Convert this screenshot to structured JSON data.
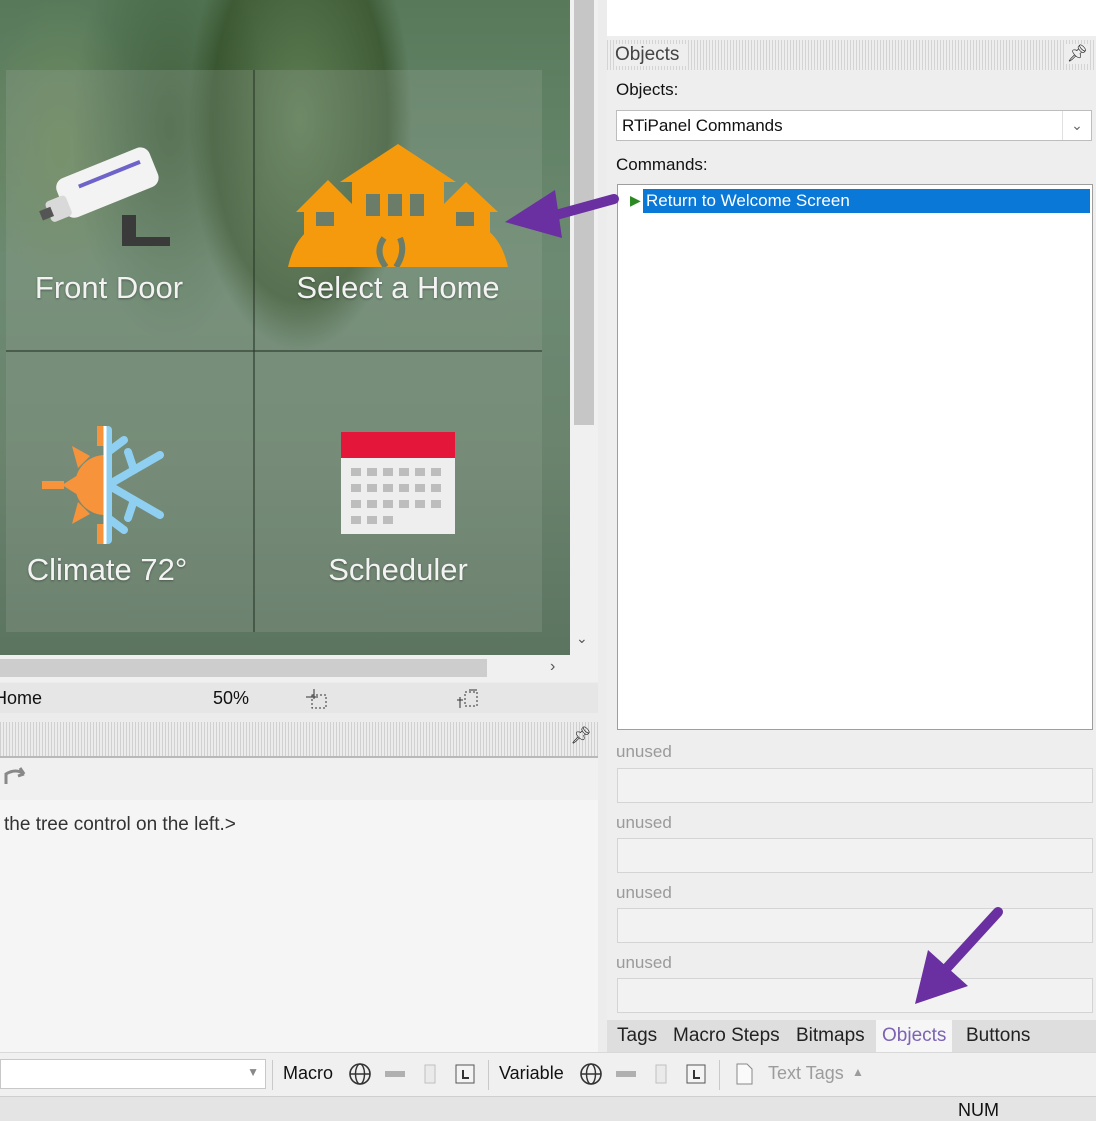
{
  "canvas": {
    "tiles": [
      {
        "label": "Front Door",
        "icon": "security-camera-icon"
      },
      {
        "label": "Select a Home",
        "icon": "homes-icon"
      },
      {
        "label": "Climate 72°",
        "icon": "climate-icon"
      },
      {
        "label": "Scheduler",
        "icon": "calendar-icon"
      }
    ]
  },
  "canvas_status": {
    "page": "Home",
    "zoom": "50%"
  },
  "lower_pane": {
    "hint": "the tree control on the left.>"
  },
  "right_panel": {
    "title": "Objects",
    "objects_label": "Objects:",
    "objects_value": "RTiPanel Commands",
    "commands_label": "Commands:",
    "commands": [
      "Return to Welcome Screen"
    ],
    "unused_fields": [
      {
        "label": "unused",
        "value": ""
      },
      {
        "label": "unused",
        "value": ""
      },
      {
        "label": "unused",
        "value": ""
      },
      {
        "label": "unused",
        "value": ""
      }
    ],
    "tabs": [
      {
        "label": "Tags",
        "active": false
      },
      {
        "label": "Macro Steps",
        "active": false
      },
      {
        "label": "Bitmaps",
        "active": false
      },
      {
        "label": "Objects",
        "active": true
      },
      {
        "label": "Buttons",
        "active": false
      }
    ]
  },
  "bottom_toolbar": {
    "macro_label": "Macro",
    "variable_label": "Variable",
    "text_tags_label": "Text Tags"
  },
  "status_bar": {
    "num": "NUM"
  },
  "colors": {
    "accent_arrow": "#6a2fa0",
    "selection": "#0a78d7",
    "home_orange": "#f59a0c",
    "active_tab": "#7c63b3"
  }
}
